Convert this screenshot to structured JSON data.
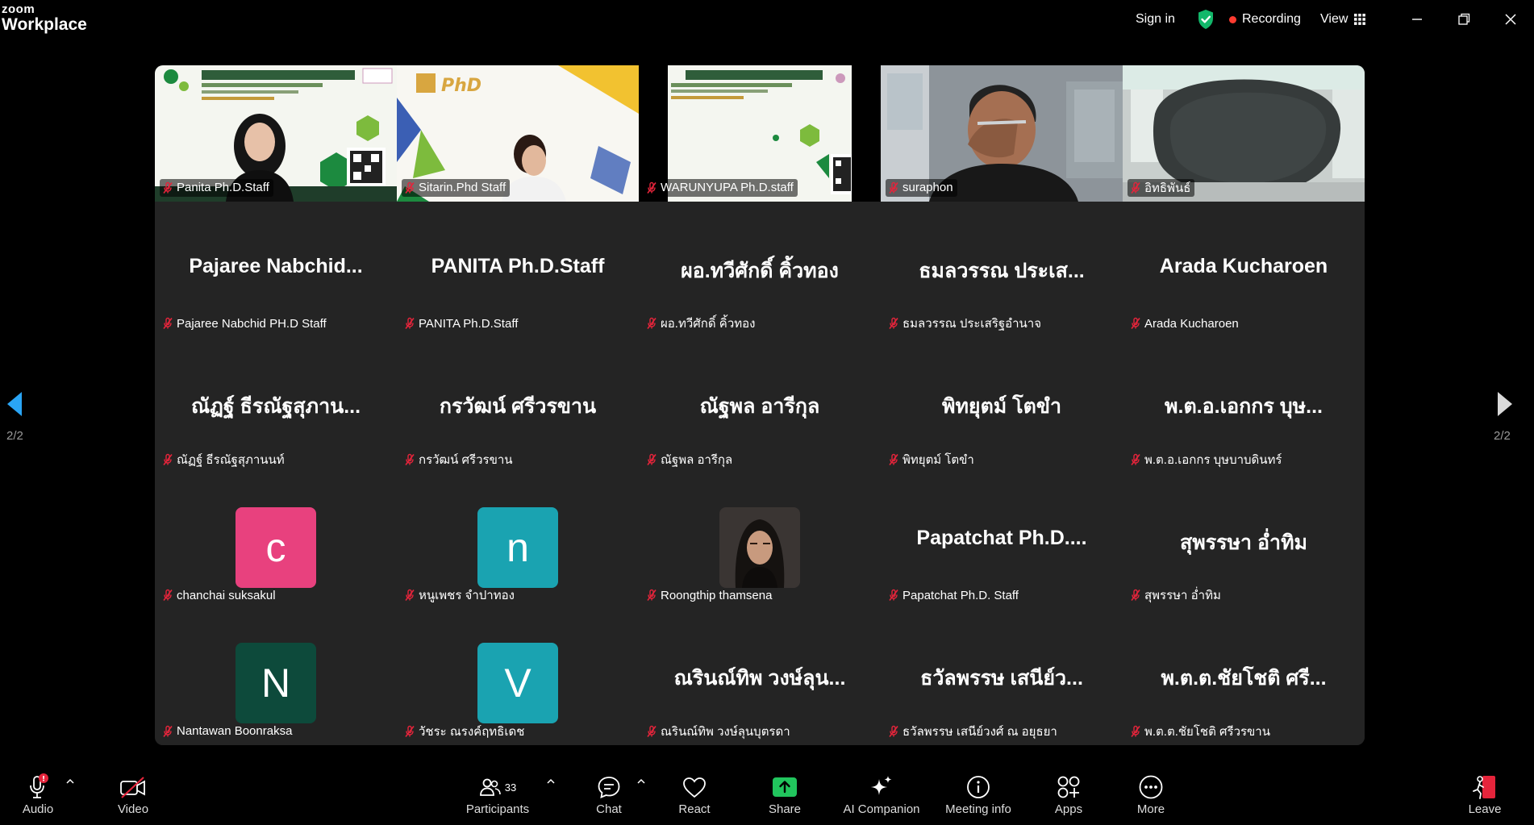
{
  "app": {
    "brand_line1": "zoom",
    "brand_line2": "Workplace"
  },
  "titlebar": {
    "sign_in": "Sign in",
    "recording": "Recording",
    "view": "View"
  },
  "colors": {
    "recording": "#ff3b30",
    "shield": "#12b76a",
    "share": "#21c55d",
    "avatar_pink": "#e8417e",
    "avatar_teal": "#1aa3b1",
    "avatar_dark_green": "#0d4a3b"
  },
  "pager": {
    "left_label": "2/2",
    "right_label": "2/2"
  },
  "tiles": [
    {
      "type": "video",
      "tag": "Panita Ph.D.Staff",
      "scene": "slide-woman"
    },
    {
      "type": "video",
      "tag": "Sitarin.Phd Staff",
      "scene": "phd-slide"
    },
    {
      "type": "video",
      "tag": "WARUNYUPA Ph.D.staff",
      "scene": "slide"
    },
    {
      "type": "video",
      "tag": "suraphon",
      "scene": "man"
    },
    {
      "type": "video",
      "tag": "อิทธิพันธ์",
      "scene": "chair"
    },
    {
      "type": "name",
      "big": "Pajaree  Nabchid...",
      "tag": "Pajaree Nabchid PH.D Staff"
    },
    {
      "type": "name",
      "big": "PANITA Ph.D.Staff",
      "tag": "PANITA Ph.D.Staff"
    },
    {
      "type": "name",
      "big": "ผอ.ทวีศักดิ์  คิ้วทอง",
      "tag": "ผอ.ทวีศักดิ์  คิ้วทอง"
    },
    {
      "type": "name",
      "big": "ธมลวรรณ ประเส...",
      "tag": "ธมลวรรณ ประเสริฐอำนาจ"
    },
    {
      "type": "name",
      "big": "Arada Kucharoen",
      "tag": "Arada Kucharoen"
    },
    {
      "type": "name",
      "big": "ณัฏฐ์ ธีรณัฐสุภาน...",
      "tag": "ณัฏฐ์ ธีรณัฐสุภานนท์"
    },
    {
      "type": "name",
      "big": "กรวัฒน์ ศรีวรขาน",
      "tag": "กรวัฒน์ ศรีวรขาน"
    },
    {
      "type": "name",
      "big": "ณัฐพล อารีกุล",
      "tag": "ณัฐพล อารีกุล"
    },
    {
      "type": "name",
      "big": "พิทยุตม์  โตขำ",
      "tag": "พิทยุตม์  โตขำ"
    },
    {
      "type": "name",
      "big": "พ.ต.อ.เอกกร บุษ...",
      "tag": "พ.ต.อ.เอกกร บุษบาบดินทร์"
    },
    {
      "type": "avatar",
      "letter": "c",
      "color": "#e8417e",
      "tag": "chanchai suksakul"
    },
    {
      "type": "avatar",
      "letter": "n",
      "color": "#1aa3b1",
      "tag": "หนูเพชร จำปาทอง"
    },
    {
      "type": "photo",
      "tag": "Roongthip thamsena"
    },
    {
      "type": "name",
      "big": "Papatchat  Ph.D....",
      "tag": "Papatchat Ph.D. Staff"
    },
    {
      "type": "name",
      "big": "สุพรรษา อ่ำทิม",
      "tag": "สุพรรษา อ่ำทิม"
    },
    {
      "type": "avatar",
      "letter": "N",
      "color": "#0d4a3b",
      "tag": "Nantawan Boonraksa"
    },
    {
      "type": "avatar",
      "letter": "V",
      "color": "#1aa3b1",
      "tag": "วัชระ ณรงค์ฤทธิเดช"
    },
    {
      "type": "name",
      "big": "ณรินณ์ทิพ วงษ์ลุน...",
      "tag": "ณรินณ์ทิพ วงษ์ลุนบุตรดา"
    },
    {
      "type": "name",
      "big": "ธวัลพรรษ เสนีย์ว...",
      "tag": "ธวัลพรรษ เสนีย์วงศ์ ณ อยุธยา"
    },
    {
      "type": "name",
      "big": "พ.ต.ต.ชัยโชติ ศรี...",
      "tag": "พ.ต.ต.ชัยโชติ ศรีวรขาน"
    }
  ],
  "toolbar": {
    "audio": "Audio",
    "video": "Video",
    "participants": "Participants",
    "participants_count": "33",
    "chat": "Chat",
    "react": "React",
    "share": "Share",
    "ai_companion": "AI Companion",
    "meeting_info": "Meeting info",
    "apps": "Apps",
    "more": "More",
    "leave": "Leave"
  }
}
